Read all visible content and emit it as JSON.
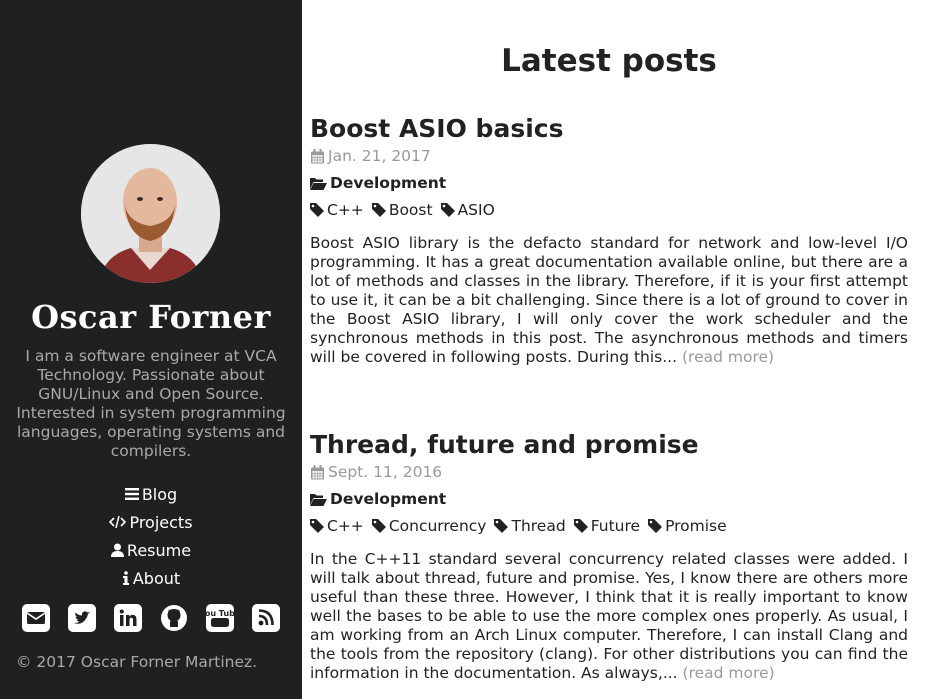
{
  "sidebar": {
    "author_name": "Oscar Forner",
    "bio": "I am a software engineer at VCA Technology. Passionate about GNU/Linux and Open Source. Interested in system programming languages, operating systems and compilers.",
    "nav": [
      {
        "label": "Blog",
        "icon": "bars-icon"
      },
      {
        "label": "Projects",
        "icon": "code-icon"
      },
      {
        "label": "Resume",
        "icon": "user-icon"
      },
      {
        "label": "About",
        "icon": "info-icon"
      }
    ],
    "socials": [
      "email-icon",
      "twitter-icon",
      "linkedin-icon",
      "github-icon",
      "youtube-icon",
      "rss-icon"
    ],
    "youtube_text": "You Tube",
    "copyright": "© 2017 Oscar Forner Martinez."
  },
  "main": {
    "page_title": "Latest posts",
    "posts": [
      {
        "title": "Boost ASIO basics",
        "date": "Jan. 21, 2017",
        "category": "Development",
        "tags": [
          "C++",
          "Boost",
          "ASIO"
        ],
        "excerpt": "Boost ASIO library is the defacto standard for network and low-level I/O programming. It has a great documentation available online, but there are a lot of methods and classes in the library. Therefore, if it is your first attempt to use it, it can be a bit challenging. Since there is a lot of ground to cover in the Boost ASIO library, I will only cover the work scheduler and the synchronous methods in this post. The asynchronous methods and timers will be covered in following posts. During this...",
        "read_more": "(read more)"
      },
      {
        "title": "Thread, future and promise",
        "date": "Sept. 11, 2016",
        "category": "Development",
        "tags": [
          "C++",
          "Concurrency",
          "Thread",
          "Future",
          "Promise"
        ],
        "excerpt": "In the C++11 standard several concurrency related classes were added. I will talk about thread, future and promise. Yes, I know there are others more useful than these three. However, I think that it is really important to know well the bases to be able to use the more complex ones properly. As usual, I am working from an Arch Linux computer. Therefore, I can install Clang and the tools from the repository (clang). For other distributions you can find the information in the documentation. As always,...",
        "read_more": "(read more)"
      }
    ]
  }
}
